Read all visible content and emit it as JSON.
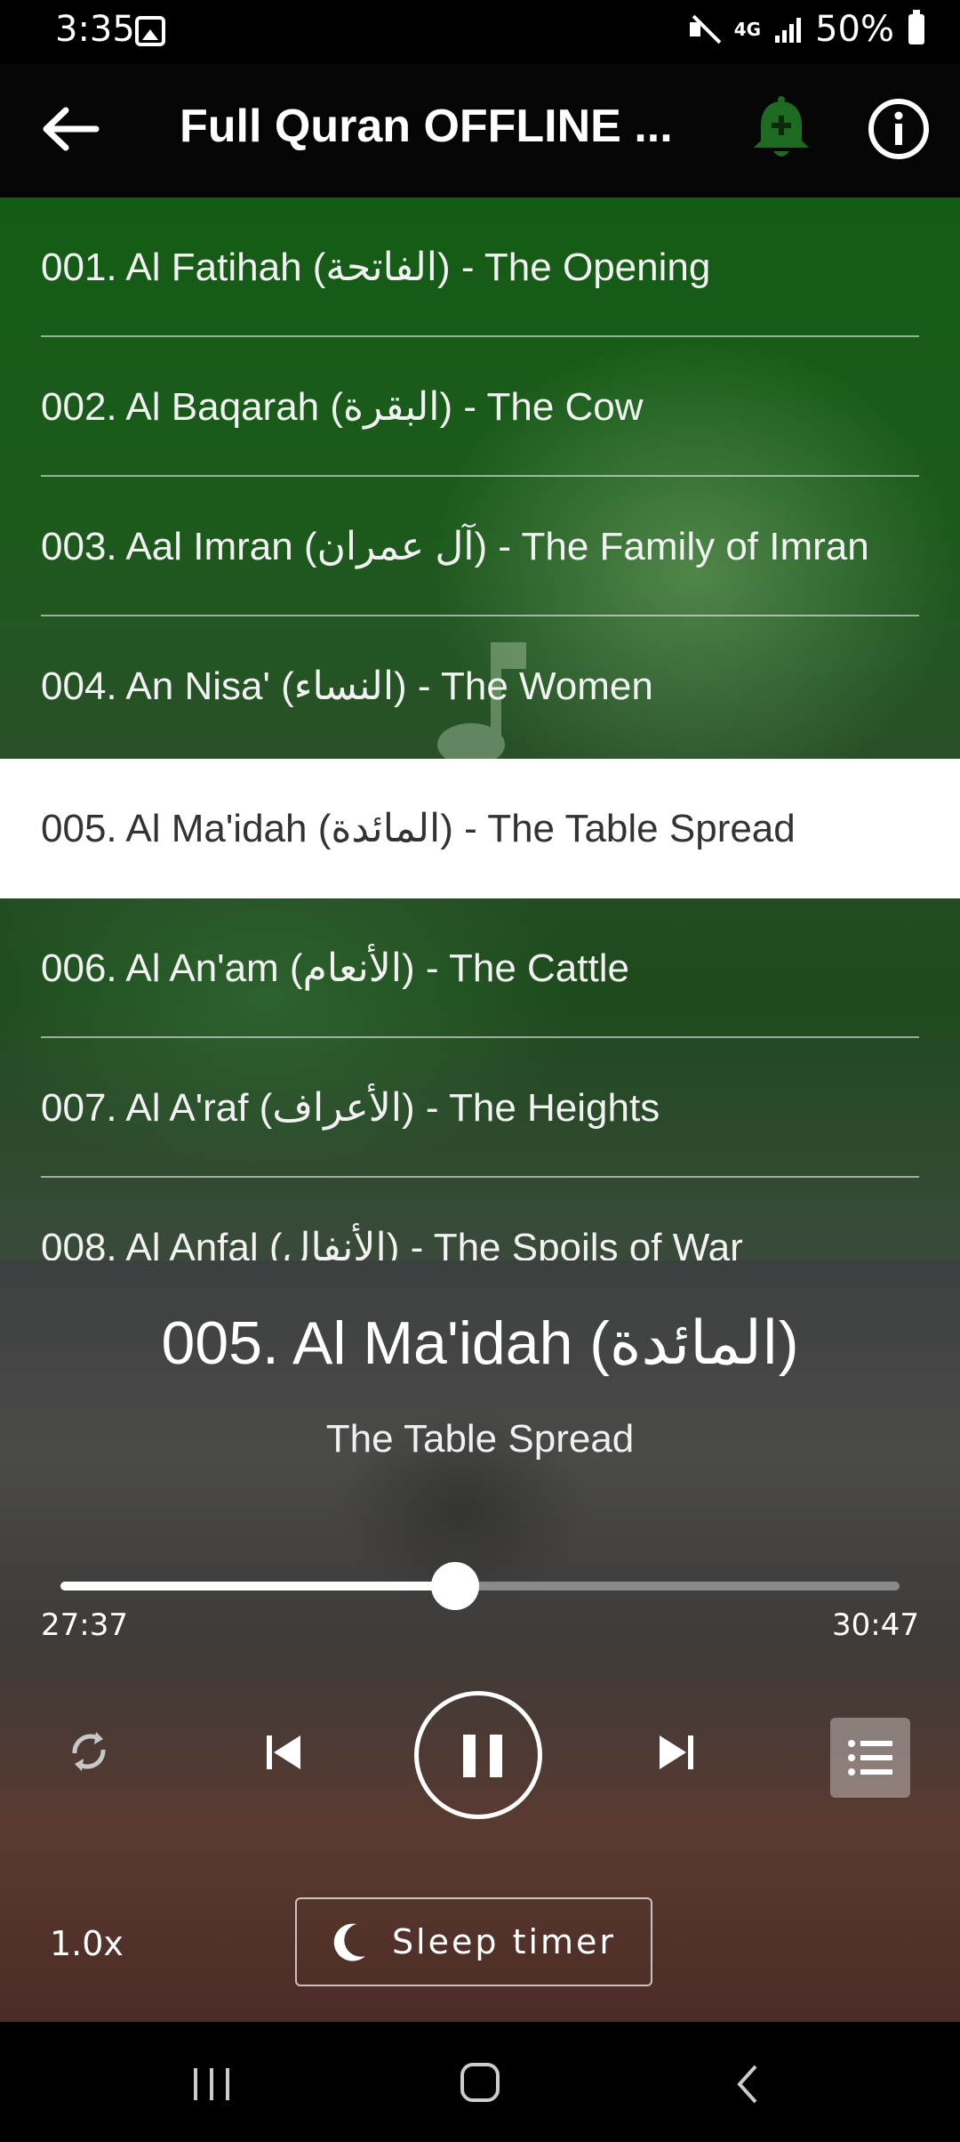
{
  "status_bar": {
    "time": "3:35",
    "network": "4G",
    "battery": "50%"
  },
  "app_bar": {
    "title": "Full Quran OFFLINE ..."
  },
  "surah_list": {
    "items": [
      {
        "label": "001. Al Fatihah (الفاتحة) - The Opening"
      },
      {
        "label": "002. Al Baqarah (البقرة) - The Cow"
      },
      {
        "label": "003. Aal Imran (آل عمران) - The Family of Imran"
      },
      {
        "label": "004. An Nisa' (النساء) - The Women"
      },
      {
        "label": "005. Al Ma'idah (المائدة) - The Table Spread"
      },
      {
        "label": "006. Al An'am (الأنعام) - The Cattle"
      },
      {
        "label": "007. Al A'raf (الأعراف) - The Heights"
      },
      {
        "label": "008. Al Anfal (الأنفال) - The Spoils of War"
      }
    ],
    "active_index": 4
  },
  "player": {
    "title": "005. Al Ma'idah (المائدة)",
    "subtitle": "The Table Spread",
    "elapsed": "27:37",
    "total": "30:47",
    "progress_fraction": 0.47,
    "speed": "1.0x",
    "sleep_timer_label": "Sleep timer"
  },
  "colors": {
    "accent_bell": "#1d6b22",
    "active_row_bg": "#ffffff"
  }
}
